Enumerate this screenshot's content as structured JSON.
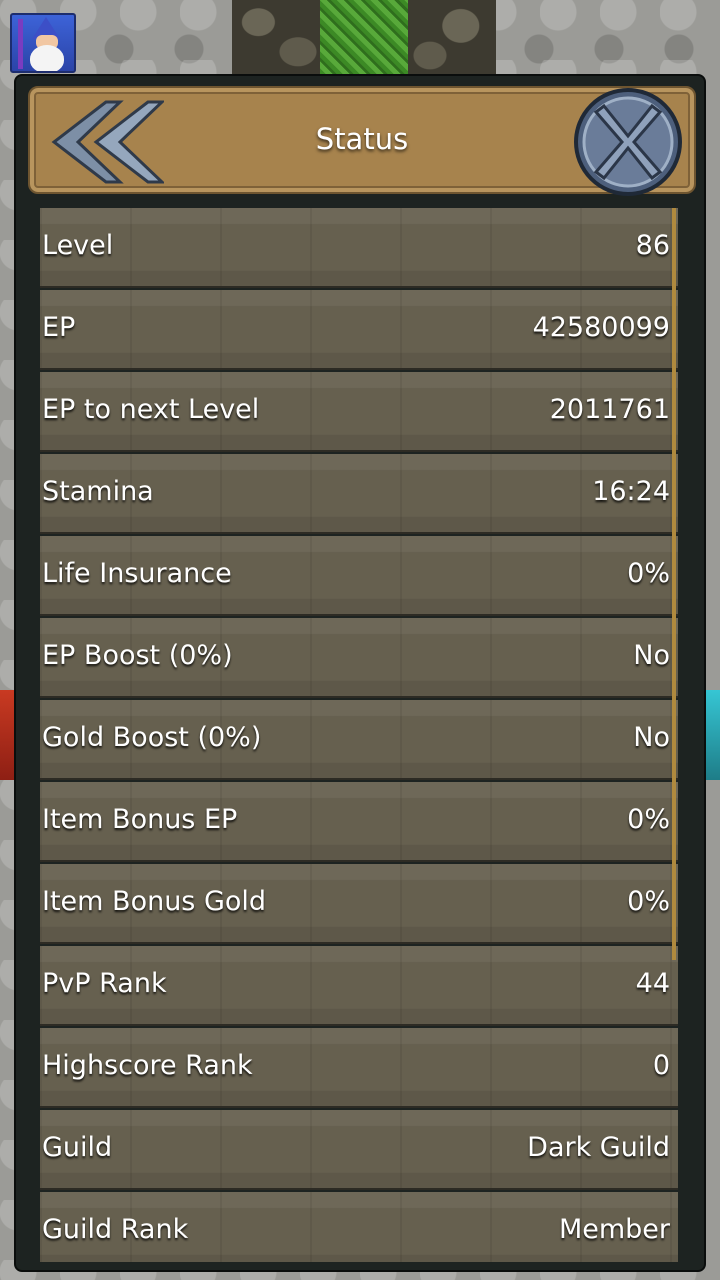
{
  "header": {
    "title": "Status"
  },
  "stats": [
    {
      "label": "Level",
      "value": "86"
    },
    {
      "label": "EP",
      "value": "42580099"
    },
    {
      "label": "EP to next Level",
      "value": "2011761"
    },
    {
      "label": "Stamina",
      "value": "16:24"
    },
    {
      "label": "Life Insurance",
      "value": "0%"
    },
    {
      "label": "EP Boost (0%)",
      "value": "No"
    },
    {
      "label": "Gold Boost (0%)",
      "value": "No"
    },
    {
      "label": "Item Bonus EP",
      "value": "0%"
    },
    {
      "label": "Item Bonus Gold",
      "value": "0%"
    },
    {
      "label": "PvP Rank",
      "value": "44"
    },
    {
      "label": "Highscore Rank",
      "value": "0"
    },
    {
      "label": "Guild",
      "value": "Dark Guild"
    },
    {
      "label": "Guild Rank",
      "value": "Member"
    }
  ],
  "icons": {
    "back": "double-chevron-left-icon",
    "close": "close-x-icon",
    "avatar": "wizard-avatar-icon"
  },
  "colors": {
    "header_bg": "#a7834d",
    "row_bg": "#66604f",
    "panel_bg": "#1d2321",
    "text": "#ffffff"
  }
}
